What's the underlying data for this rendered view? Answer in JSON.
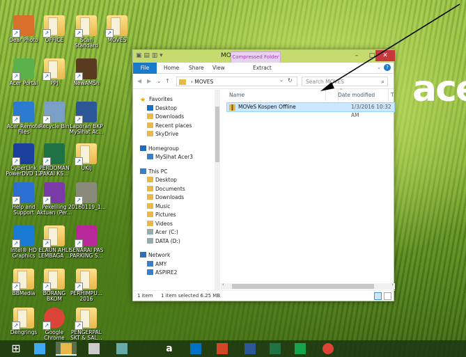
{
  "desktop": {
    "icons": [
      {
        "label": "Dear Photo",
        "kind": "photo"
      },
      {
        "label": "OFFICE",
        "kind": "folder"
      },
      {
        "label": "Scan\nStandard",
        "kind": "folder"
      },
      {
        "label": "MOVES",
        "kind": "folder"
      },
      {
        "label": "Acer Portal",
        "kind": "cloud"
      },
      {
        "label": "PPJ",
        "kind": "folder"
      },
      {
        "label": "NewAMSh",
        "kind": "book"
      },
      {
        "label": "Acer Remote\nFiles",
        "kind": "wifi"
      },
      {
        "label": "Recycle Bin",
        "kind": "bin"
      },
      {
        "label": "Laporan BKP\nMySihat Ac...",
        "kind": "word"
      },
      {
        "label": "CyberLink\nPowerDVD 12",
        "kind": "dvd"
      },
      {
        "label": "PERDOMAN\nPAKAI KS...",
        "kind": "excel"
      },
      {
        "label": "UKIJ",
        "kind": "folder"
      },
      {
        "label": "Help and\nSupport",
        "kind": "help"
      },
      {
        "label": "Pekeliling\nAktuan (Per...",
        "kind": "rar"
      },
      {
        "label": "20160119_1...",
        "kind": "photo2"
      },
      {
        "label": "Intel® HD\nGraphics",
        "kind": "intel"
      },
      {
        "label": "ELAUN AHLI\nLEMBAGA ...",
        "kind": "folder"
      },
      {
        "label": "SENARAI PAS\nPARKING S...",
        "kind": "rar2"
      },
      {
        "label": "BBMedia",
        "kind": "folder"
      },
      {
        "label": "BORANG\nBKOM",
        "kind": "folder"
      },
      {
        "label": "PERHIMPU...\n2016",
        "kind": "folder"
      },
      {
        "label": "Dengrings",
        "kind": "folder"
      },
      {
        "label": "Google\nChrome",
        "kind": "chrome"
      },
      {
        "label": "PENGERPAL\nSKT & SAL...",
        "kind": "folder"
      }
    ],
    "brand": "ace"
  },
  "window": {
    "title": "MOVES",
    "context_tab": "Compressed Folder Tools",
    "context_sub": "Extract",
    "ribbon_tabs": [
      "File",
      "Home",
      "Share",
      "View"
    ],
    "path": "MOVES",
    "search_placeholder": "Search MOVES",
    "nav": {
      "favorites": "Favorites",
      "favorites_items": [
        "Desktop",
        "Downloads",
        "Recent places",
        "SkyDrive"
      ],
      "homegroup": "Homegroup",
      "homegroup_items": [
        "MySihat Acer3"
      ],
      "thispc": "This PC",
      "thispc_items": [
        "Desktop",
        "Documents",
        "Downloads",
        "Music",
        "Pictures",
        "Videos",
        "Acer (C:)",
        "DATA (D:)"
      ],
      "network": "Network",
      "network_items": [
        "AMY",
        "ASPIRE2"
      ]
    },
    "columns": {
      "name": "Name",
      "date": "Date modified",
      "type": "T"
    },
    "files": [
      {
        "name": "MOVeS Kospen Offline",
        "date": "1/3/2016 10:32 AM"
      }
    ],
    "status": {
      "count": "1 item",
      "selected": "1 item selected  6.25 MB"
    }
  },
  "taskbar": {
    "items": [
      "windows-start",
      "internet-explorer",
      "file-explorer",
      "media",
      "store",
      "amazon",
      "outlook",
      "powerpoint",
      "word",
      "excel",
      "green-app",
      "chrome"
    ],
    "amazon_glyph": "a"
  },
  "colors": {
    "title_bar": "#c5db6e",
    "file_tab": "#1979ca",
    "selection": "#cce8ff",
    "close": "#c7373c"
  }
}
